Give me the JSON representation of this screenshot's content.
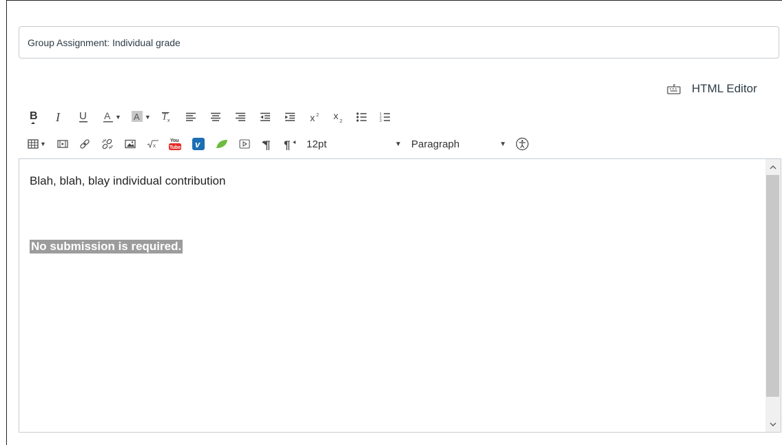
{
  "title_input": {
    "value": "Group Assignment: Individual grade"
  },
  "html_editor": {
    "label": "HTML Editor",
    "icon": "keyboard-icon"
  },
  "toolbar": {
    "row1": [
      "bold-icon",
      "italic-icon",
      "underline-icon",
      "text-color-icon",
      "background-color-icon",
      "clear-formatting-icon",
      "align-left-icon",
      "align-center-icon",
      "align-right-icon",
      "outdent-icon",
      "indent-icon",
      "superscript-icon",
      "subscript-icon",
      "bullet-list-icon",
      "numbered-list-icon"
    ],
    "row2": [
      "table-icon",
      "media-icon",
      "link-icon",
      "unlink-icon",
      "image-icon",
      "equation-icon",
      "youtube-icon",
      "vimeo-icon",
      "leaf-icon",
      "embed-media-icon",
      "ltr-icon",
      "rtl-icon",
      "accessibility-icon"
    ],
    "font_size": "12pt",
    "block_format": "Paragraph"
  },
  "editor": {
    "line1": "Blah, blah, blay individual contribution",
    "line2": "No submission is required.",
    "highlight_color": "#9c9c9c"
  },
  "colors": {
    "text": "#2d3b45",
    "border": "#c7cdd1",
    "youtube": "#e52d27",
    "vimeo": "#1a6fb5",
    "leaf": "#6dbb3f"
  }
}
